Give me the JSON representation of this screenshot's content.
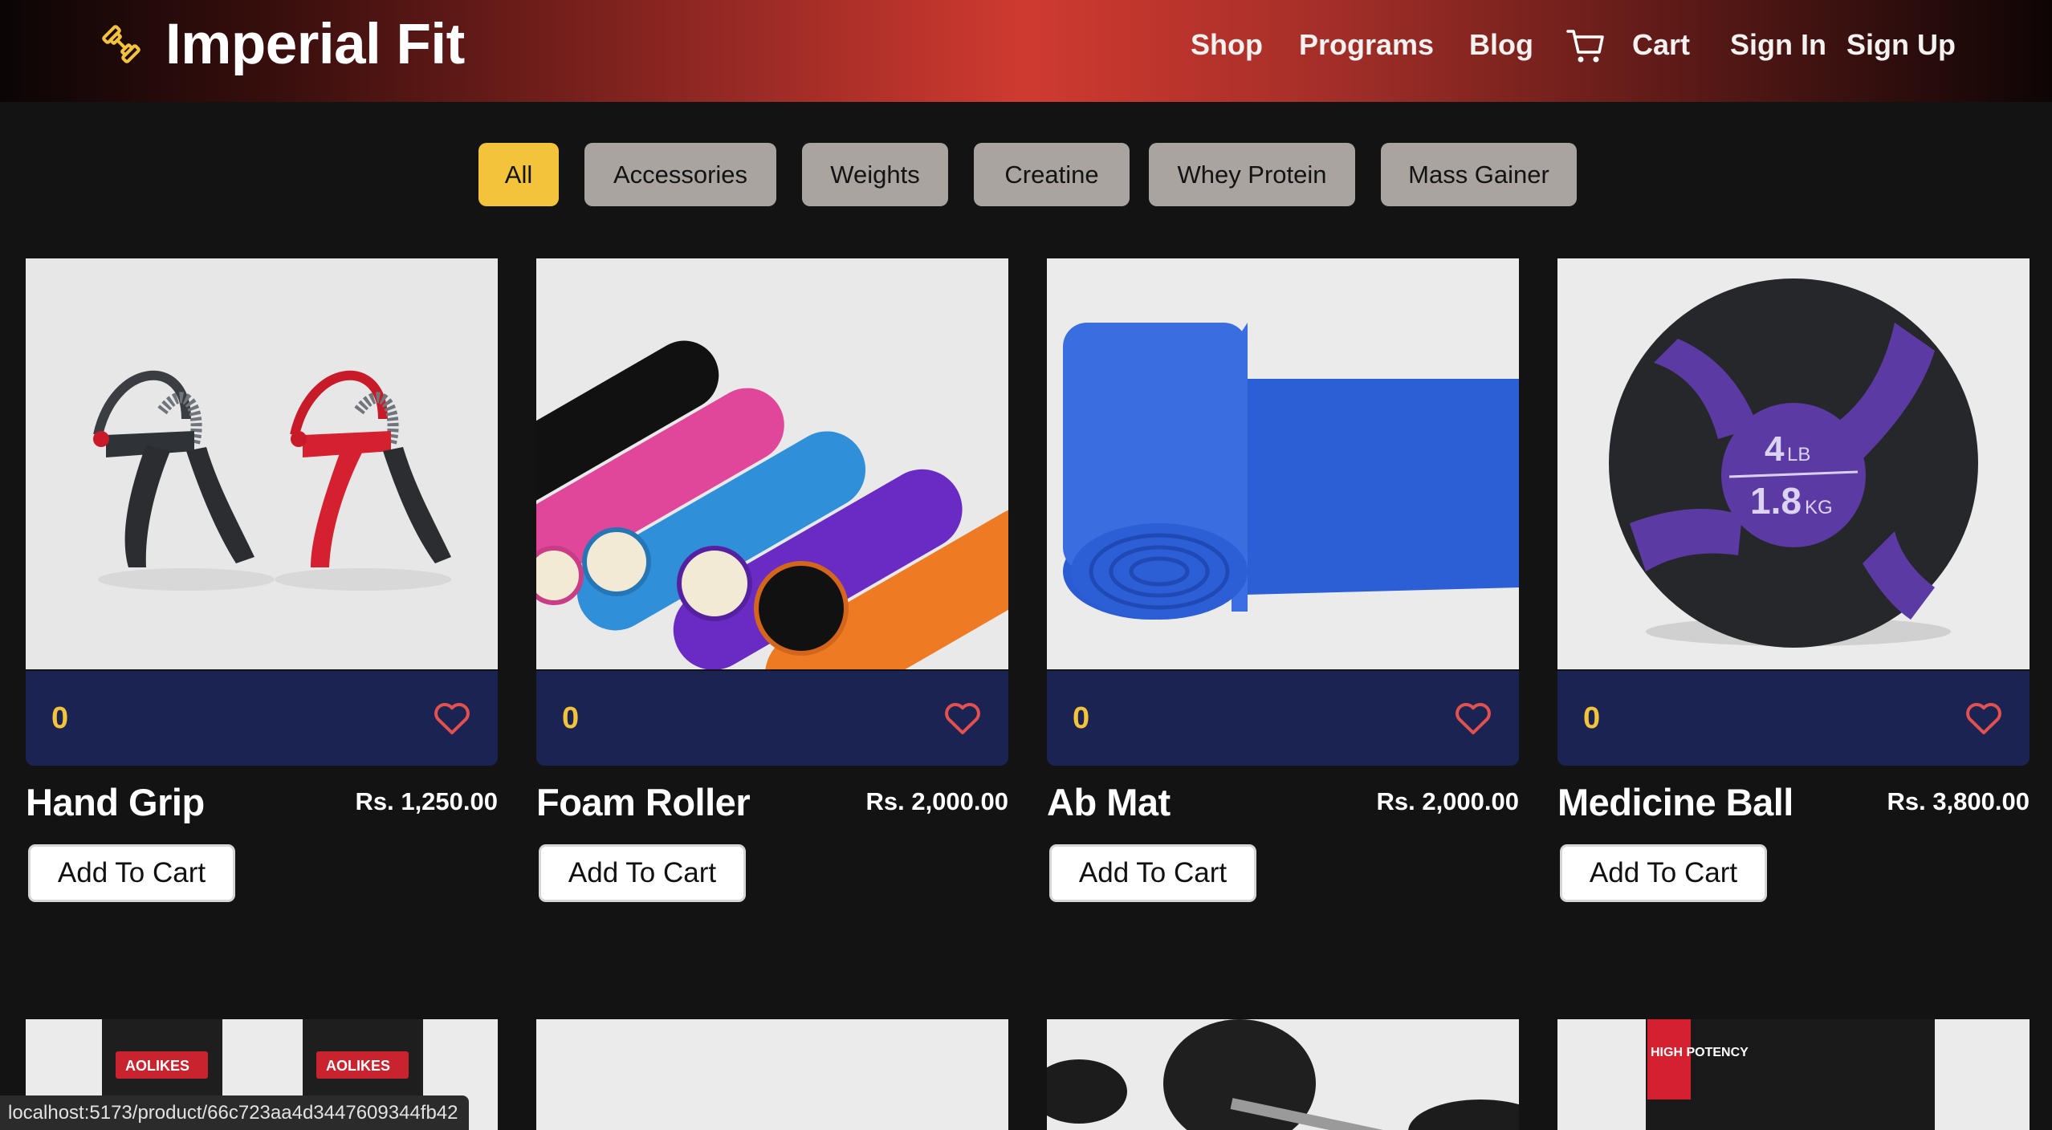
{
  "header": {
    "brand": "Imperial Fit",
    "nav": {
      "shop": "Shop",
      "programs": "Programs",
      "blog": "Blog",
      "cart": "Cart",
      "sign_in": "Sign In",
      "sign_up": "Sign Up"
    },
    "icons": {
      "logo": "dumbbell-icon",
      "cart": "shopping-cart-icon"
    }
  },
  "filters": {
    "active": "All",
    "items": [
      "All",
      "Accessories",
      "Weights",
      "Creatine",
      "Whey Protein",
      "Mass Gainer"
    ]
  },
  "products": [
    {
      "name": "Hand Grip",
      "price": "Rs. 1,250.00",
      "likes": "0",
      "button": "Add To Cart"
    },
    {
      "name": "Foam Roller",
      "price": "Rs. 2,000.00",
      "likes": "0",
      "button": "Add To Cart"
    },
    {
      "name": "Ab Mat",
      "price": "Rs. 2,000.00",
      "likes": "0",
      "button": "Add To Cart"
    },
    {
      "name": "Medicine Ball",
      "price": "Rs. 3,800.00",
      "likes": "0",
      "button": "Add To Cart"
    }
  ],
  "product_image_text": {
    "medicine_ball_lb": "4",
    "medicine_ball_lb_unit": "LB",
    "medicine_ball_kg": "1.8",
    "medicine_ball_kg_unit": "KG",
    "wrist_wrap_brand": "AOLIKES",
    "supplement_label": "HIGH POTENCY"
  },
  "status_bar": {
    "url": "localhost:5173/product/66c723aa4d3447609344fb42"
  },
  "colors": {
    "page_bg": "#131313",
    "header_accent": "#cf3a30",
    "filter_active": "#f3c33c",
    "filter_inactive": "#a9a4a0",
    "card_bar": "#1b2352",
    "likes_text": "#f3c33c",
    "heart": "#e2514f"
  }
}
